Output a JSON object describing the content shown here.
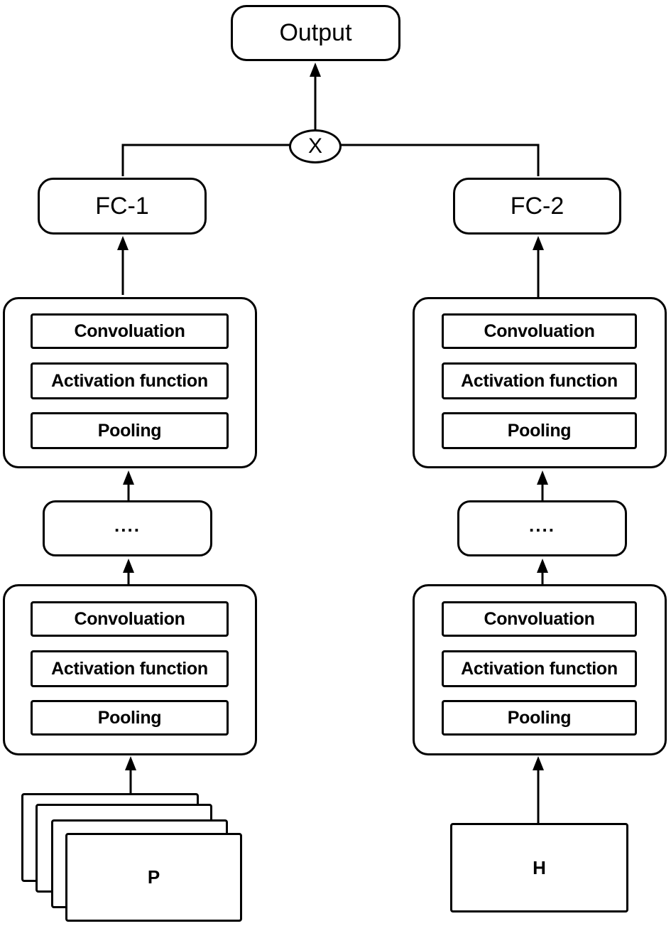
{
  "output": {
    "label": "Output"
  },
  "multiply": {
    "label": "X"
  },
  "left_branch": {
    "fc_label": "FC-1",
    "top_block": {
      "layers": [
        "Convoluation",
        "Activation function",
        "Pooling"
      ]
    },
    "ellipsis": "....",
    "bottom_block": {
      "layers": [
        "Convoluation",
        "Activation function",
        "Pooling"
      ]
    },
    "input_label": "P"
  },
  "right_branch": {
    "fc_label": "FC-2",
    "top_block": {
      "layers": [
        "Convoluation",
        "Activation function",
        "Pooling"
      ]
    },
    "ellipsis": "....",
    "bottom_block": {
      "layers": [
        "Convoluation",
        "Activation function",
        "Pooling"
      ]
    },
    "input_label": "H"
  }
}
